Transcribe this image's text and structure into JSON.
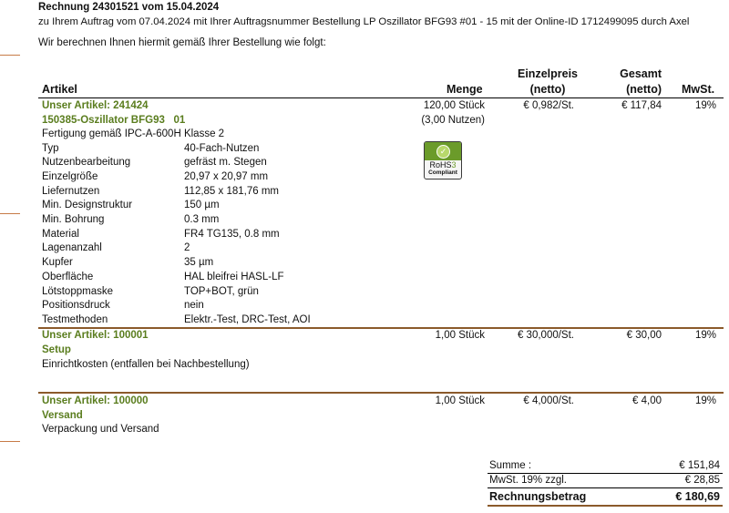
{
  "header": {
    "title": "Rechnung 24301521 vom 15.04.2024",
    "subtitle": "zu Ihrem Auftrag vom 07.04.2024 mit Ihrer Auftragsnummer Bestellung LP Oszillator BFG93 #01 - 15 mit der Online-ID 1712499095 durch Axel",
    "intro": "Wir berechnen Ihnen hiermit gemäß Ihrer Bestellung wie folgt:"
  },
  "columns": {
    "artikel": "Artikel",
    "menge": "Menge",
    "einzelpreis_1": "Einzelpreis",
    "einzelpreis_2": "(netto)",
    "gesamt_1": "Gesamt",
    "gesamt_2": "(netto)",
    "mwst": "MwSt."
  },
  "items": [
    {
      "artikel_nr": "Unser Artikel: 241424",
      "name": "150385-Oszillator BFG93   01",
      "desc": "Fertigung gemäß IPC-A-600H Klasse 2",
      "menge": "120,00 Stück",
      "menge_sub": "(3,00 Nutzen)",
      "einzelpreis": "€ 0,982/St.",
      "gesamt": "€ 117,84",
      "mwst": "19%",
      "badge_main": "RoHS",
      "badge_suffix": "3",
      "badge_sub": "Compliant",
      "specs": [
        {
          "k": "Typ",
          "v": "40-Fach-Nutzen"
        },
        {
          "k": "Nutzenbearbeitung",
          "v": "gefräst m. Stegen"
        },
        {
          "k": "Einzelgröße",
          "v": "20,97 x 20,97 mm"
        },
        {
          "k": "Liefernutzen",
          "v": "112,85 x 181,76 mm"
        },
        {
          "k": "Min. Designstruktur",
          "v": "150 µm"
        },
        {
          "k": "Min. Bohrung",
          "v": "0.3 mm"
        },
        {
          "k": "Material",
          "v": "FR4 TG135, 0.8 mm"
        },
        {
          "k": "Lagenanzahl",
          "v": "2"
        },
        {
          "k": "Kupfer",
          "v": "35 µm"
        },
        {
          "k": "Oberfläche",
          "v": "HAL bleifrei HASL-LF"
        },
        {
          "k": "Lötstoppmaske",
          "v": "TOP+BOT, grün"
        },
        {
          "k": "Positionsdruck",
          "v": "nein"
        },
        {
          "k": "Testmethoden",
          "v": "Elektr.-Test, DRC-Test, AOI"
        }
      ]
    },
    {
      "artikel_nr": "Unser Artikel: 100001",
      "name": "Setup",
      "desc": "Einrichtkosten (entfallen bei Nachbestellung)",
      "menge": "1,00 Stück",
      "einzelpreis": "€ 30,000/St.",
      "gesamt": "€ 30,00",
      "mwst": "19%"
    },
    {
      "artikel_nr": "Unser Artikel: 100000",
      "name": "Versand",
      "desc": "Verpackung und Versand",
      "menge": "1,00 Stück",
      "einzelpreis": "€ 4,000/St.",
      "gesamt": "€ 4,00",
      "mwst": "19%"
    }
  ],
  "totals": {
    "summe_label": "Summe :",
    "summe_value": "€ 151,84",
    "mwst_label": "MwSt. 19% zzgl.",
    "mwst_value": "€ 28,85",
    "betrag_label": "Rechnungsbetrag",
    "betrag_value": "€ 180,69"
  },
  "colors": {
    "accent_green": "#5a7d1e",
    "divider_brown": "#8b5a2b",
    "margin_mark": "#c77b47"
  }
}
